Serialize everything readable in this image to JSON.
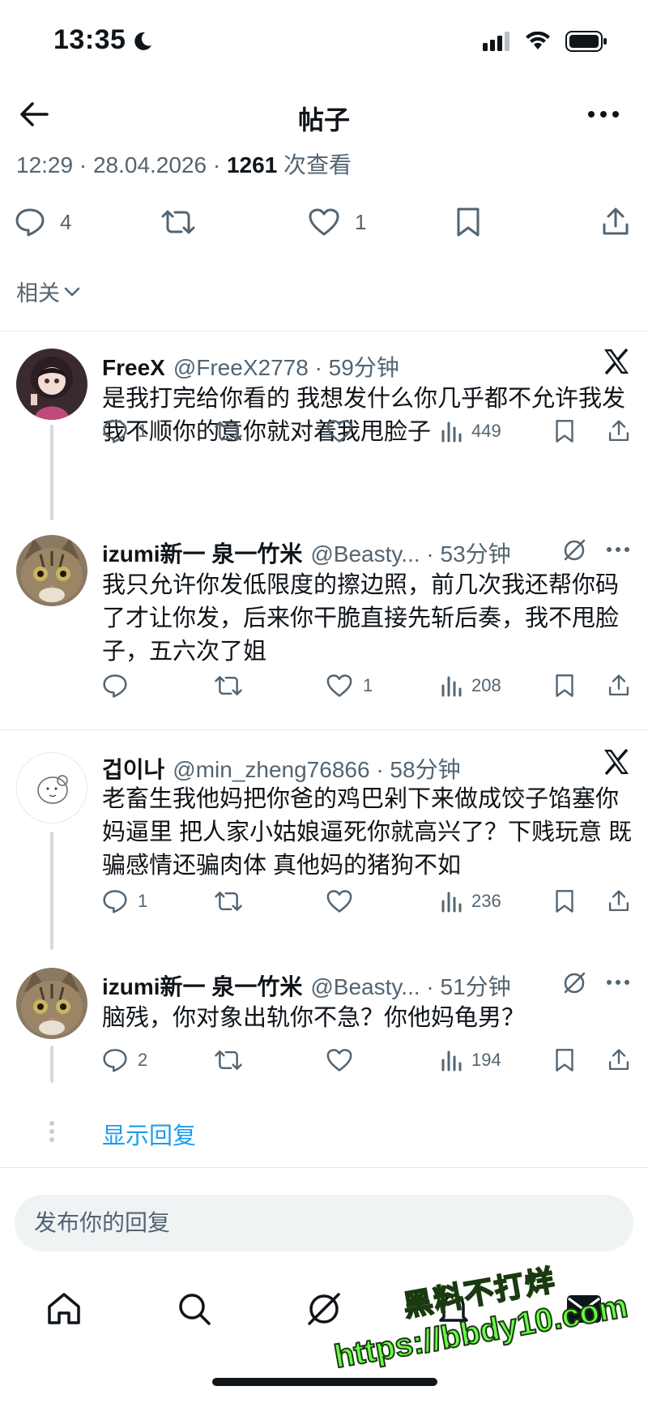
{
  "status": {
    "time": "13:35"
  },
  "header": {
    "title": "帖子"
  },
  "post": {
    "time": "12:29 · 28.04.2026 · ",
    "views_count": "1261",
    "views_label": " 次查看",
    "replies": "4",
    "likes": "1"
  },
  "sort": {
    "label": "相关"
  },
  "replies": [
    {
      "name": "FreeX",
      "handle": "@FreeX2778 · 59分钟",
      "text": "是我打完给你看的 我想发什么你几乎都不允许我发 我不顺你的意你就对着我甩脸子",
      "replies": "1",
      "retweets": "",
      "likes": "",
      "views": "449"
    },
    {
      "name": "izumi新一 泉一竹米",
      "handle": "@Beasty... · 53分钟",
      "text": "我只允许你发低限度的擦边照，前几次我还帮你码了才让你发，后来你干脆直接先斩后奏，我不甩脸子，五六次了姐",
      "replies": "",
      "retweets": "",
      "likes": "1",
      "views": "208"
    },
    {
      "name": "겁이나",
      "handle": "@min_zheng76866 · 58分钟",
      "text": "老畜生我他妈把你爸的鸡巴剁下来做成饺子馅塞你妈逼里 把人家小姑娘逼死你就高兴了？下贱玩意 既骗感情还骗肉体 真他妈的猪狗不如",
      "replies": "1",
      "retweets": "",
      "likes": "",
      "views": "236"
    },
    {
      "name": "izumi新一 泉一竹米",
      "handle": "@Beasty... · 51分钟",
      "text": "脑残，你对象出轨你不急？你他妈龟男？",
      "replies": "2",
      "retweets": "",
      "likes": "",
      "views": "194"
    }
  ],
  "show_replies": "显示回复",
  "composer": {
    "placeholder": "发布你的回复"
  },
  "watermark": {
    "line1": "黑料不打烊",
    "line2": "https://bbdy10.com"
  },
  "colors": {
    "accent": "#1d9bf0",
    "muted": "#536471",
    "text": "#0f1419"
  }
}
